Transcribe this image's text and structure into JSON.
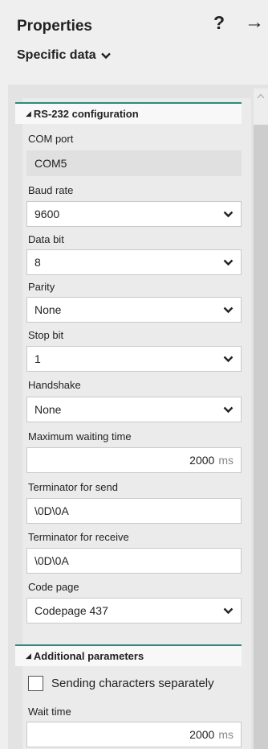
{
  "header": {
    "title": "Properties",
    "help_label": "?",
    "collapse_label": "→",
    "subtitle": "Specific data"
  },
  "rs232": {
    "section_title": "RS-232 configuration",
    "com_port": {
      "label": "COM port",
      "value": "COM5"
    },
    "baud_rate": {
      "label": "Baud rate",
      "value": "9600"
    },
    "data_bit": {
      "label": "Data bit",
      "value": "8"
    },
    "parity": {
      "label": "Parity",
      "value": "None"
    },
    "stop_bit": {
      "label": "Stop bit",
      "value": "1"
    },
    "handshake": {
      "label": "Handshake",
      "value": "None"
    },
    "max_wait": {
      "label": "Maximum waiting time",
      "value": "2000",
      "unit": "ms"
    },
    "term_send": {
      "label": "Terminator for send",
      "value": "\\0D\\0A"
    },
    "term_receive": {
      "label": "Terminator for receive",
      "value": "\\0D\\0A"
    },
    "code_page": {
      "label": "Code page",
      "value": "Codepage 437"
    }
  },
  "additional": {
    "section_title": "Additional parameters",
    "send_separately": {
      "label": "Sending characters separately",
      "checked": false
    },
    "wait_time": {
      "label": "Wait time",
      "value": "2000",
      "unit": "ms"
    }
  },
  "colors": {
    "section_accent": "#2a8a80",
    "background": "#efefef",
    "readonly_field": "#e0e0e0"
  }
}
